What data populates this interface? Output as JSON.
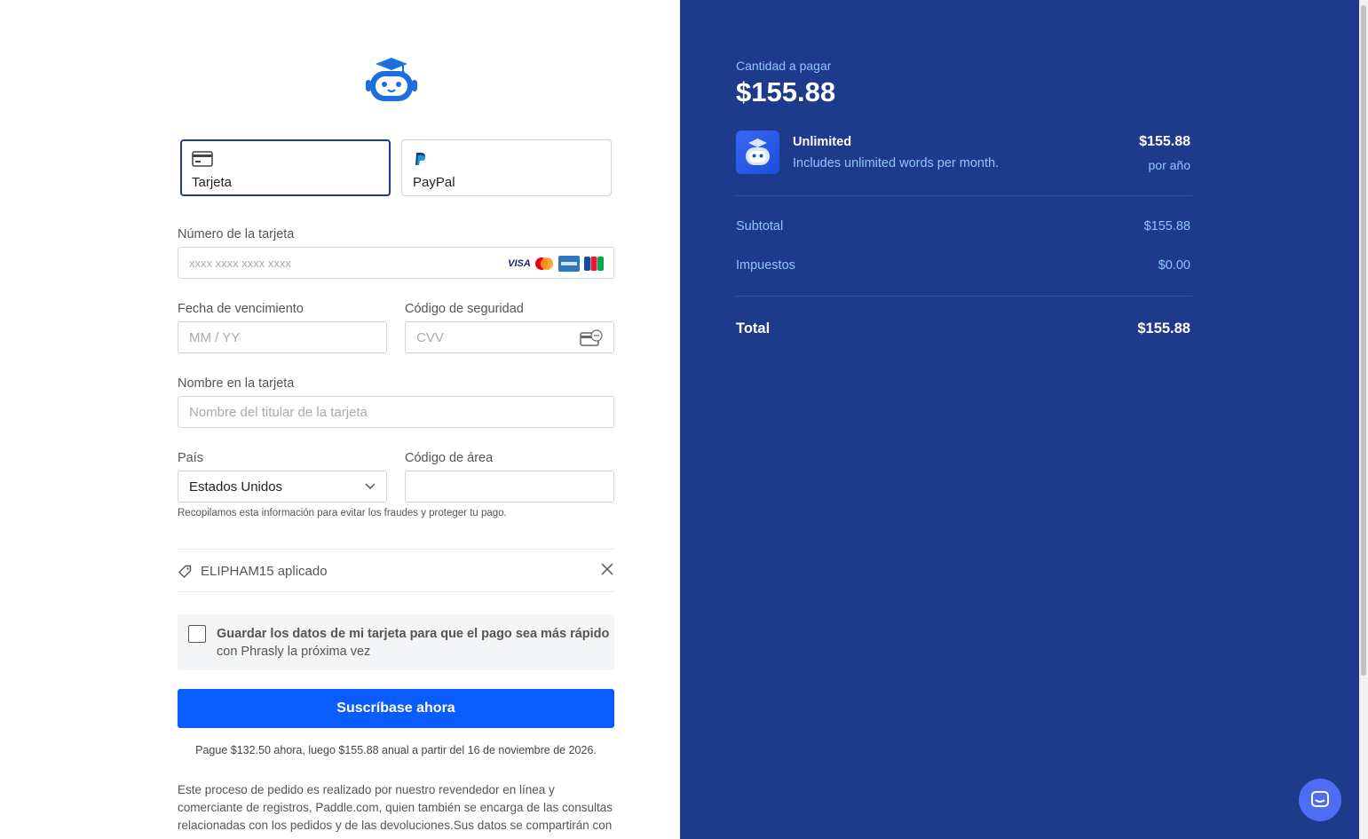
{
  "payment_methods": [
    {
      "label": "Tarjeta",
      "icon": "credit-card-icon",
      "selected": true
    },
    {
      "label": "PayPal",
      "icon": "paypal-icon",
      "selected": false
    }
  ],
  "card_number": {
    "label": "Número de la tarjeta",
    "placeholder": "xxxx xxxx xxxx xxxx",
    "brands": [
      "VISA",
      "mastercard",
      "amex",
      "JCB"
    ]
  },
  "expiry": {
    "label": "Fecha de vencimiento",
    "placeholder": "MM / YY"
  },
  "security_code": {
    "label": "Código de seguridad",
    "placeholder": "CVV"
  },
  "cardholder": {
    "label": "Nombre en la tarjeta",
    "placeholder": "Nombre del titular de la tarjeta"
  },
  "country": {
    "label": "País",
    "value": "Estados Unidos"
  },
  "postal_code": {
    "label": "Código de área",
    "value": ""
  },
  "fraud_note": "Recopilamos esta información para evitar los fraudes y proteger tu pago.",
  "coupon": {
    "text": "ELIPHAM15 aplicado"
  },
  "save_card": {
    "line1": "Guardar los datos de mi tarjeta para que el pago sea más rápido",
    "line2": "con Phrasly la próxima vez",
    "checked": false
  },
  "submit_label": "Suscríbase ahora",
  "terms": "Pague $132.50 ahora, luego $155.88 anual a partir del 16 de noviembre de 2026.",
  "disclaimer": "Este proceso de pedido es realizado por nuestro revendedor en línea y comerciante de registros, Paddle.com, quien también se encarga de las consultas relacionadas con los pedidos y de las devoluciones.Sus datos se compartirán con",
  "summary": {
    "amount_label": "Cantidad a pagar",
    "amount": "$155.88",
    "product": {
      "name": "Unlimited",
      "description": "Includes unlimited words per month.",
      "price": "$155.88",
      "period": "por año"
    },
    "subtotal_label": "Subtotal",
    "subtotal": "$155.88",
    "tax_label": "Impuestos",
    "tax": "$0.00",
    "total_label": "Total",
    "total": "$155.88"
  },
  "colors": {
    "summary_bg": "#1e3a8a",
    "accent": "#0a5cff",
    "muted_text": "#93c5fd"
  }
}
